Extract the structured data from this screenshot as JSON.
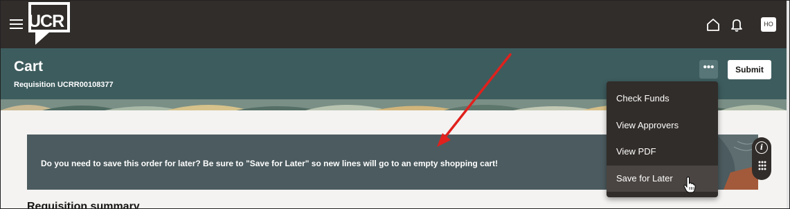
{
  "topbar": {
    "logo_text": "UCR",
    "avatar_initials": "HO",
    "icons": [
      "hamburger-menu-icon",
      "home-icon",
      "bell-icon"
    ]
  },
  "header": {
    "title": "Cart",
    "subtitle": "Requisition UCRR00108377",
    "more_label": "•••",
    "submit_label": "Submit"
  },
  "banner": {
    "text": "Do you need to save this order for later? Be sure to \"Save for Later\" so new lines will go to an empty shopping cart!"
  },
  "section": {
    "heading": "Requisition summary"
  },
  "menu": {
    "items": [
      {
        "label": "Check Funds"
      },
      {
        "label": "View Approvers"
      },
      {
        "label": "View PDF"
      },
      {
        "label": "Save for Later"
      }
    ]
  },
  "colors": {
    "topbar": "#312d2a",
    "header": "#3d5c5e",
    "banner": "#4c5b5f",
    "annotation_arrow": "#e0211d"
  },
  "info_widget": {
    "label": "i"
  }
}
